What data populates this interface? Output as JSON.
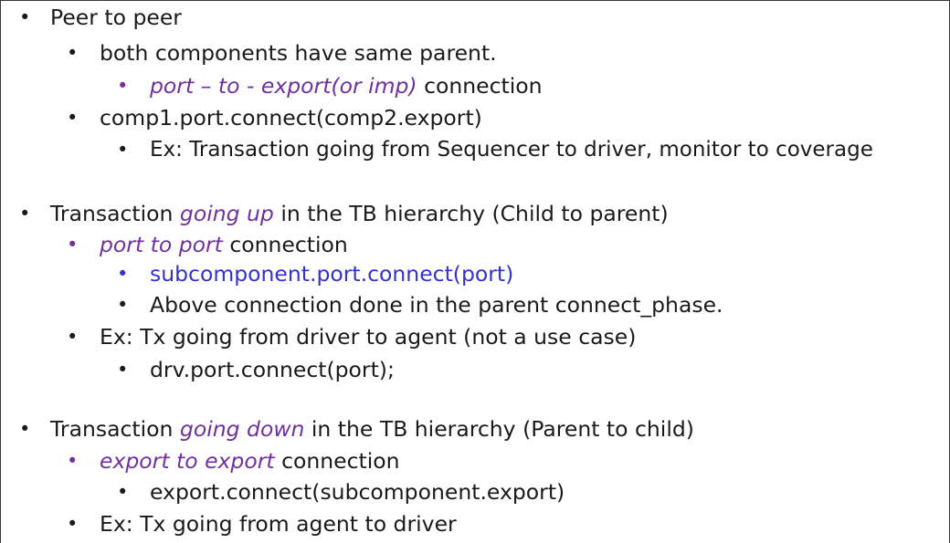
{
  "sections": [
    {
      "title": "Peer to peer",
      "both_components": "both components have same parent.",
      "connection_italic": "port – to - export(or imp)",
      "connection_rest": " connection",
      "connect_call": "comp1.port.connect(comp2.export)",
      "example": "Ex: Transaction going from Sequencer to driver, monitor to coverage"
    },
    {
      "title_prefix": "Transaction ",
      "title_italic": "going up",
      "title_suffix": " in the TB hierarchy (Child to parent)",
      "connection_italic": "port to port",
      "connection_rest": " connection",
      "connect_call": "subcomponent.port.connect(port)",
      "note": "Above connection done in the parent connect_phase.",
      "example": "Ex:  Tx going from driver to agent (not a use case)",
      "example_call": "drv.port.connect(port);"
    },
    {
      "title_prefix": "Transaction ",
      "title_italic": "going down",
      "title_suffix": " in the TB hierarchy (Parent to child)",
      "connection_italic": "export to export",
      "connection_rest": " connection",
      "connect_call": "export.connect(subcomponent.export)",
      "example": "Ex: Tx going from agent to driver"
    }
  ],
  "bullet_glyph": "•",
  "colors": {
    "text": "#1a1a1a",
    "purple": "#7030a0",
    "blue": "#3333cc"
  }
}
